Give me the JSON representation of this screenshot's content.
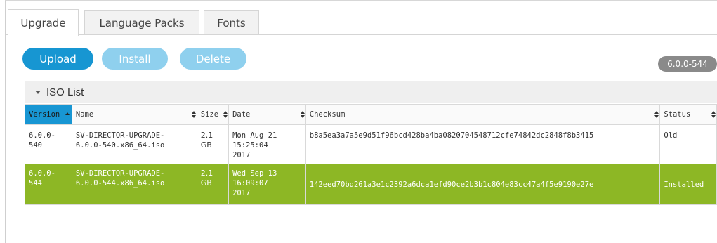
{
  "tabs": [
    "Upgrade",
    "Language Packs",
    "Fonts"
  ],
  "toolbar": {
    "upload_label": "Upload",
    "install_label": "Install",
    "delete_label": "Delete"
  },
  "version_badge": "6.0.0-544",
  "panel": {
    "title": "ISO List"
  },
  "table": {
    "headers": [
      "Version",
      "Name",
      "Size",
      "Date",
      "Checksum",
      "Status"
    ],
    "rows": [
      {
        "version": "6.0.0-\n540",
        "name": "SV-DIRECTOR-UPGRADE-\n6.0.0-540.x86_64.iso",
        "size": "2.1\nGB",
        "date": "Mon Aug 21\n15:25:04\n2017",
        "checksum": "b8a5ea3a7a5e9d51f96bcd428ba4ba0820704548712cfe74842dc2848f8b3415",
        "status": "Old"
      },
      {
        "version": "6.0.0-\n544",
        "name": "SV-DIRECTOR-UPGRADE-\n6.0.0-544.x86_64.iso",
        "size": "2.1\nGB",
        "date": "Wed Sep 13\n16:09:07\n2017",
        "checksum": "142eed70bd261a3e1c2392a6dca1efd90ce2b3b1c804e83cc47a4f5e9190e27e",
        "status": "Installed"
      }
    ]
  },
  "colors": {
    "accent": "#1796d2",
    "accent_disabled": "#8fd0ee",
    "selected_row": "#8db725",
    "badge": "#8a8a8a"
  }
}
